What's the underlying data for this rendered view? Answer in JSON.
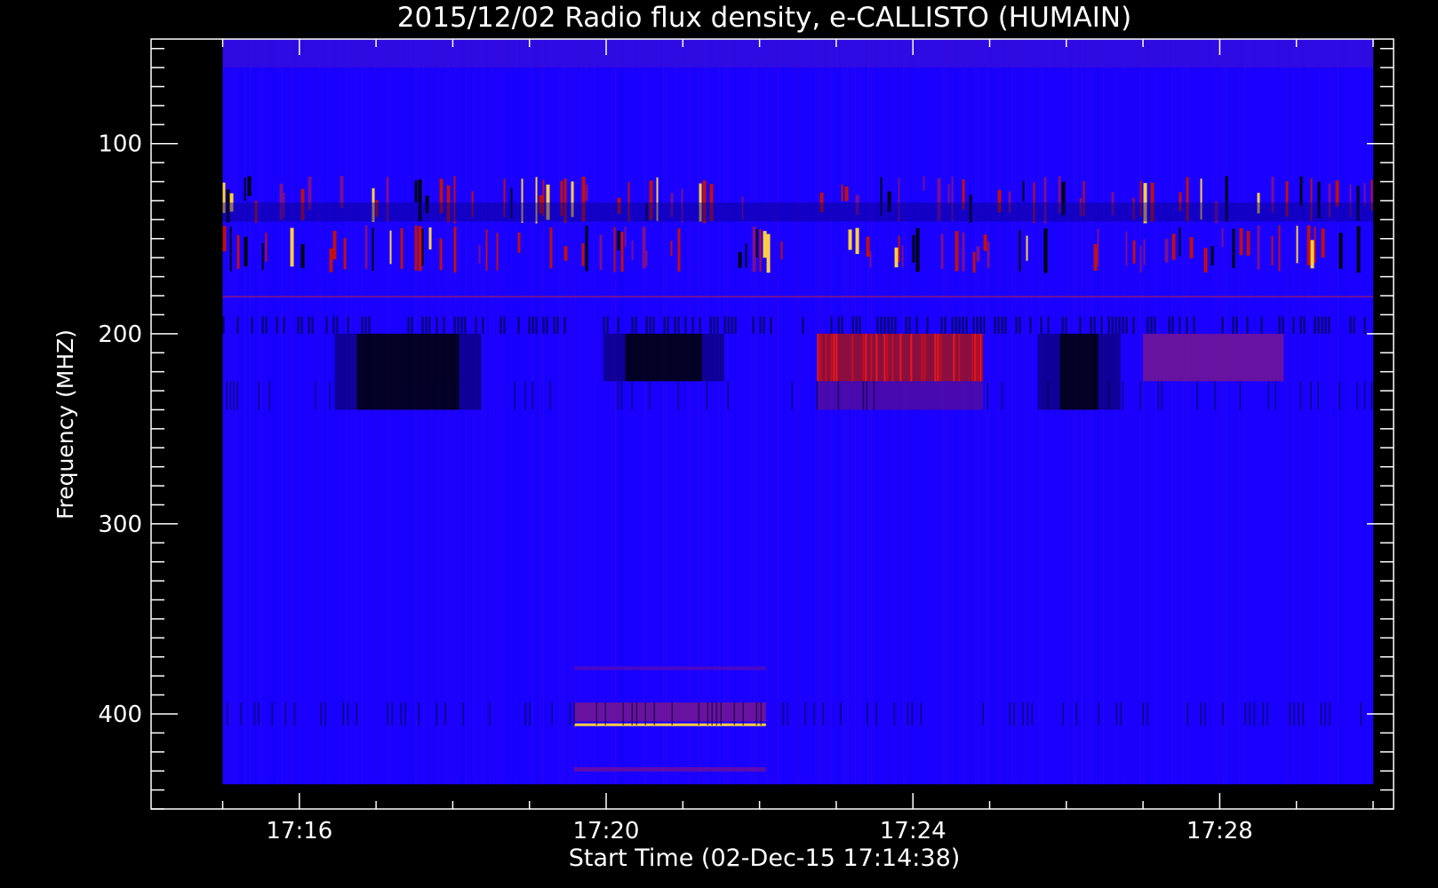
{
  "chart_data": {
    "type": "heatmap",
    "title": "2015/12/02  Radio flux density, e-CALLISTO (HUMAIN)",
    "xlabel": "Start Time (02-Dec-15 17:14:38)",
    "ylabel": "Frequency (MHZ)",
    "x_axis": {
      "unit": "time",
      "range": [
        "17:14:04",
        "17:30:16"
      ],
      "data_range": [
        "17:15:00",
        "17:30:00"
      ],
      "major_ticks": [
        "17:16",
        "17:20",
        "17:24",
        "17:28"
      ],
      "minor_step_minutes": 1
    },
    "y_axis": {
      "unit": "MHz",
      "range": [
        45,
        450
      ],
      "data_range": [
        45,
        437
      ],
      "reversed": true,
      "major_ticks": [
        100,
        200,
        300,
        400
      ],
      "minor_step": 10
    },
    "colormap": "blue-red-yellow",
    "colors": {
      "background": "#000000",
      "low": "#000000",
      "base": "#1a00ff",
      "mid": "#c01010",
      "high": "#ffd040"
    },
    "features": [
      {
        "label": "bursty interference band",
        "freq_range": [
          117,
          142
        ],
        "time_range": [
          "17:15:00",
          "17:30:00"
        ],
        "level": "high",
        "pattern": "intermittent"
      },
      {
        "label": "sparse spike lines",
        "freq_range": [
          143,
          168
        ],
        "time_range": [
          "17:15:00",
          "17:30:00"
        ],
        "level": "high",
        "pattern": "intermittent"
      },
      {
        "label": "steady line",
        "freq_range": [
          180,
          181
        ],
        "time_range": [
          "17:15:00",
          "17:30:00"
        ],
        "level": "medium"
      },
      {
        "label": "dark depletion",
        "freq_range": [
          200,
          240
        ],
        "time_range": [
          "17:16:45",
          "17:18:05"
        ],
        "level": "low"
      },
      {
        "label": "dark depletion",
        "freq_range": [
          200,
          225
        ],
        "time_range": [
          "17:20:15",
          "17:21:15"
        ],
        "level": "low"
      },
      {
        "label": "enhanced emission",
        "freq_range": [
          200,
          225
        ],
        "time_range": [
          "17:22:45",
          "17:24:55"
        ],
        "level": "high"
      },
      {
        "label": "dark depletion",
        "freq_range": [
          200,
          240
        ],
        "time_range": [
          "17:25:55",
          "17:26:25"
        ],
        "level": "low"
      },
      {
        "label": "moderate emission",
        "freq_range": [
          200,
          225
        ],
        "time_range": [
          "17:27:00",
          "17:28:50"
        ],
        "level": "medium"
      },
      {
        "label": "narrowband line",
        "freq_range": [
          405,
          406
        ],
        "time_range": [
          "17:19:35",
          "17:22:05"
        ],
        "level": "high"
      },
      {
        "label": "side band",
        "freq_range": [
          394,
          404
        ],
        "time_range": [
          "17:19:35",
          "17:22:05"
        ],
        "level": "medium"
      }
    ]
  }
}
